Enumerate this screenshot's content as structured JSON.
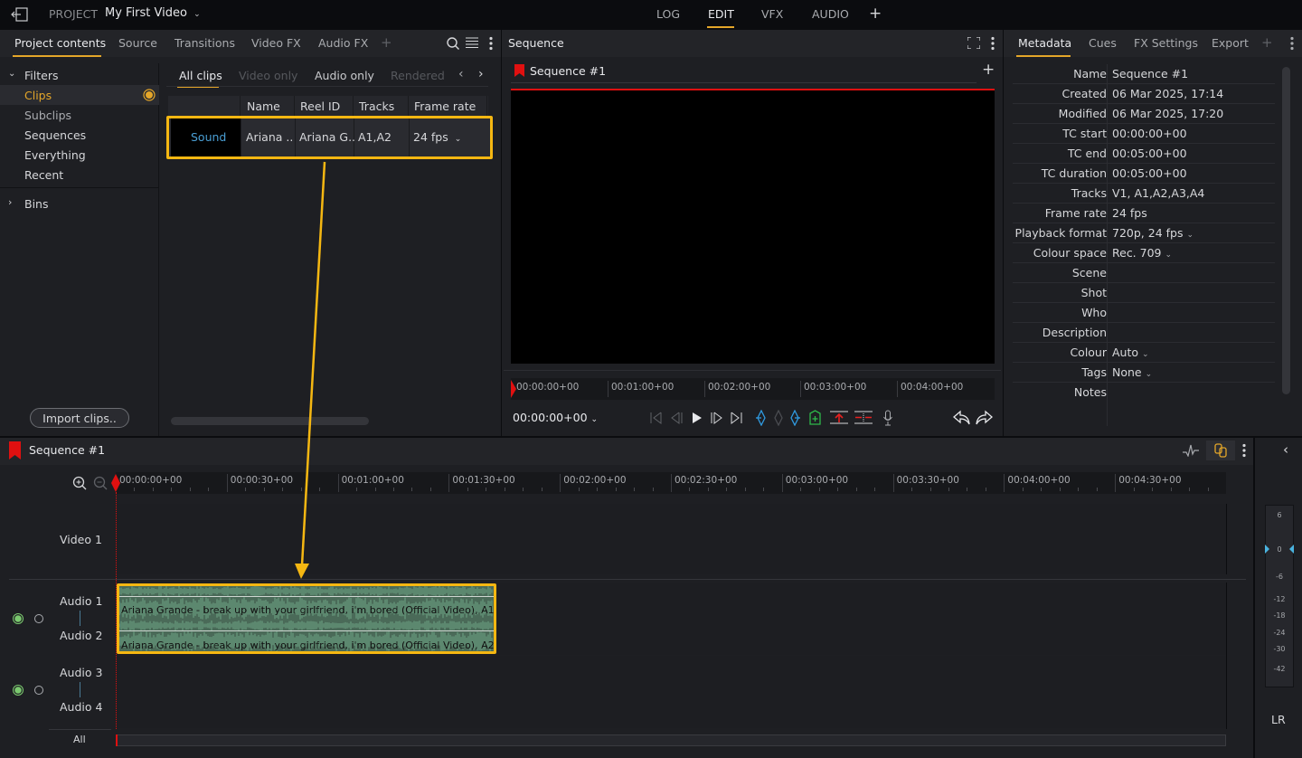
{
  "topbar": {
    "project_label": "PROJECT",
    "project_name": "My First Video",
    "modes": [
      "LOG",
      "EDIT",
      "VFX",
      "AUDIO"
    ],
    "active_mode": "EDIT"
  },
  "left_panel": {
    "tabs": [
      "Project contents",
      "Source",
      "Transitions",
      "Video FX",
      "Audio FX"
    ],
    "active_tab": "Project contents",
    "filters_label": "Filters",
    "filters": [
      "Clips",
      "Subclips",
      "Sequences",
      "Everything",
      "Recent"
    ],
    "active_filter": "Clips",
    "bins_label": "Bins",
    "import_button": "Import clips..",
    "clip_tabs": [
      "All clips",
      "Video only",
      "Audio only",
      "Rendered"
    ],
    "active_clip_tab": "All clips",
    "table": {
      "columns": [
        "",
        "Name",
        "Reel ID",
        "Tracks",
        "Frame rate"
      ],
      "rows": [
        {
          "thumb": "Sound",
          "name": "Ariana ..",
          "reel_id": "Ariana G..",
          "tracks": "A1,A2",
          "frame_rate": "24 fps"
        }
      ]
    }
  },
  "sequence_panel": {
    "title": "Sequence",
    "sequence_name": "Sequence #1",
    "ruler_ticks": [
      "00:00:00+00",
      "00:01:00+00",
      "00:02:00+00",
      "00:03:00+00",
      "00:04:00+00"
    ],
    "timecode": "00:00:00+00"
  },
  "metadata_panel": {
    "tabs": [
      "Metadata",
      "Cues",
      "FX Settings",
      "Export"
    ],
    "active_tab": "Metadata",
    "rows": [
      {
        "key": "Name",
        "value": "Sequence #1"
      },
      {
        "key": "Created",
        "value": "06 Mar 2025, 17:14"
      },
      {
        "key": "Modified",
        "value": "06 Mar 2025, 17:20"
      },
      {
        "key": "TC start",
        "value": "00:00:00+00"
      },
      {
        "key": "TC end",
        "value": "00:05:00+00"
      },
      {
        "key": "TC duration",
        "value": "00:05:00+00"
      },
      {
        "key": "Tracks",
        "value": "V1, A1,A2,A3,A4"
      },
      {
        "key": "Frame rate",
        "value": "24 fps"
      },
      {
        "key": "Playback format",
        "value": "720p, 24 fps",
        "dropdown": true
      },
      {
        "key": "Colour space",
        "value": "Rec. 709",
        "dropdown": true
      },
      {
        "key": "Scene",
        "value": ""
      },
      {
        "key": "Shot",
        "value": ""
      },
      {
        "key": "Who",
        "value": ""
      },
      {
        "key": "Description",
        "value": ""
      },
      {
        "key": "Colour",
        "value": "Auto",
        "dropdown": true
      },
      {
        "key": "Tags",
        "value": "None",
        "dropdown": true
      },
      {
        "key": "Notes",
        "value": ""
      }
    ]
  },
  "timeline": {
    "sequence_name": "Sequence #1",
    "ruler_ticks": [
      "00:00:00+00",
      "00:00:30+00",
      "00:01:00+00",
      "00:01:30+00",
      "00:02:00+00",
      "00:02:30+00",
      "00:03:00+00",
      "00:03:30+00",
      "00:04:00+00",
      "00:04:30+00"
    ],
    "tracks": {
      "video1": "Video 1",
      "audio1": "Audio 1",
      "audio2": "Audio 2",
      "audio3": "Audio 3",
      "audio4": "Audio 4",
      "all": "All"
    },
    "clip_a1": "Ariana Grande - break up with your girlfriend, i'm bored (Official Video), A1",
    "clip_a2": "Ariana Grande - break up with your girlfriend, i'm bored (Official Video), A2",
    "meter_labels": [
      "6",
      "0",
      "-6",
      "-12",
      "-18",
      "-24",
      "-30",
      "-42"
    ],
    "meter_channel": "LR"
  },
  "colors": {
    "accent": "#e4a629",
    "highlight": "#f5b712",
    "playhead": "#e01010",
    "clip_fill": "#4a6a58"
  }
}
